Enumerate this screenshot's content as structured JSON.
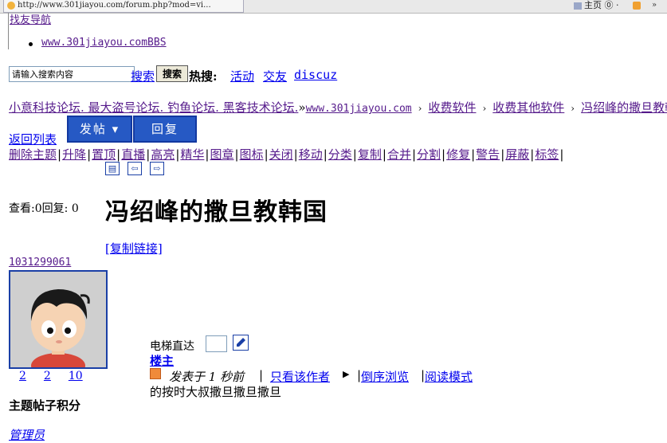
{
  "browser": {
    "tab_title": "http://www.301jiayou.com/forum.php?mod=vi...",
    "home_label": "主页",
    "home_suffix": "⓪ ·"
  },
  "top": {
    "cut_link": "找友导航",
    "bbs_link": "www.301jiayou.comBBS"
  },
  "search": {
    "input_value": "请输入搜索内容",
    "search_link": "搜索",
    "button_label": "搜索",
    "hot_label": "热搜:",
    "hot_items": [
      "活动",
      "交友",
      "discuz"
    ]
  },
  "breadcrumb": {
    "first": "小意科技论坛. 最大盗号论坛. 钓鱼论坛. 黑客技术论坛.",
    "arrow": "»",
    "site": "www.301jiayou.com",
    "items": [
      "收费软件",
      "收费其他软件",
      "冯绍峰的撒旦教韩国"
    ]
  },
  "actions": {
    "back_list": "返回列表",
    "post_button": "发帖 ▾",
    "reply_button": "回复"
  },
  "mod_bar": [
    "删除主题",
    "升降",
    "置顶",
    "直播",
    "高亮",
    "精华",
    "图章",
    "图标",
    "关闭",
    "移动",
    "分类",
    "复制",
    "合并",
    "分割",
    "修复",
    "警告",
    "屏蔽",
    "标签"
  ],
  "tool_icons": [
    "print-icon",
    "prev-thread-icon",
    "next-thread-icon"
  ],
  "thread": {
    "views_label": "查看:",
    "views": "0",
    "replies_label": "回复:",
    "replies": "0",
    "title": "冯绍峰的撒旦教韩国",
    "copy_link": "[复制链接]"
  },
  "author": {
    "uid": "1031299061",
    "stats": [
      "2",
      "2",
      "10"
    ],
    "score_label": "主题帖子积分",
    "role_link": "管理员"
  },
  "post": {
    "elevator_label": "电梯直达",
    "floor": "楼主",
    "posted": "发表于 1 秒前",
    "only_author": "只看该作者",
    "reverse": "倒序浏览",
    "read_mode": "阅读模式",
    "body": "的按时大叔撒旦撒旦撒旦"
  },
  "colors": {
    "button_blue": "#2659c4",
    "link": "#0000ee",
    "visited": "#551a8b"
  }
}
